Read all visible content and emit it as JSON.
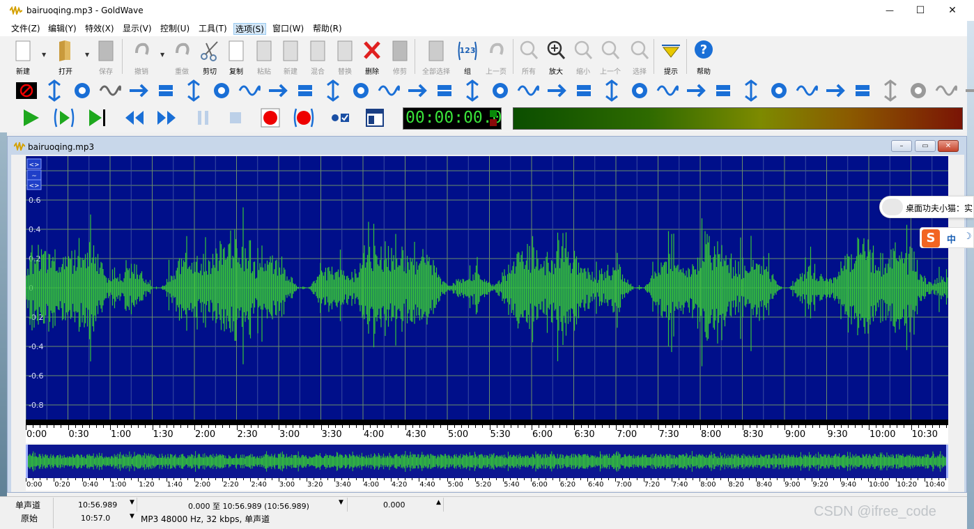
{
  "window": {
    "title": "bairuoqing.mp3 - GoldWave",
    "minimize": "—",
    "maximize": "☐",
    "close": "✕"
  },
  "menu": [
    {
      "label": "文件(Z)"
    },
    {
      "label": "编辑(Y)"
    },
    {
      "label": "特效(X)"
    },
    {
      "label": "显示(V)"
    },
    {
      "label": "控制(U)"
    },
    {
      "label": "工具(T)"
    },
    {
      "label": "选项(S)"
    },
    {
      "label": "窗口(W)"
    },
    {
      "label": "帮助(R)"
    }
  ],
  "toolbar": {
    "buttons": [
      {
        "label": "新建",
        "icon": "new-file-icon"
      },
      {
        "label": "打开",
        "icon": "open-folder-icon"
      },
      {
        "label": "保存",
        "icon": "save-disk-icon"
      },
      {
        "label": "撤销",
        "icon": "undo-icon"
      },
      {
        "label": "重做",
        "icon": "redo-icon"
      },
      {
        "label": "剪切",
        "icon": "scissors-icon"
      },
      {
        "label": "复制",
        "icon": "copy-icon"
      },
      {
        "label": "粘贴",
        "icon": "paste-icon"
      },
      {
        "label": "新建",
        "icon": "paste-new-icon"
      },
      {
        "label": "混合",
        "icon": "mix-icon"
      },
      {
        "label": "替换",
        "icon": "replace-icon"
      },
      {
        "label": "删除",
        "icon": "delete-x-icon"
      },
      {
        "label": "修剪",
        "icon": "trim-icon"
      },
      {
        "label": "全部选择",
        "icon": "select-all-icon"
      },
      {
        "label": "组",
        "icon": "group-123-icon"
      },
      {
        "label": "上一页",
        "icon": "previous-icon"
      },
      {
        "label": "所有",
        "icon": "zoom-all-icon"
      },
      {
        "label": "放大",
        "icon": "zoom-in-icon"
      },
      {
        "label": "缩小",
        "icon": "zoom-out-icon"
      },
      {
        "label": "上一个",
        "icon": "zoom-previous-icon"
      },
      {
        "label": "选择",
        "icon": "zoom-selection-icon"
      },
      {
        "label": "提示",
        "icon": "cue-triangle-icon"
      },
      {
        "label": "帮助",
        "icon": "help-question-icon"
      }
    ]
  },
  "counter": {
    "time": "00:00:00.0"
  },
  "document": {
    "title": "bairuoqing.mp3",
    "restore": "▭",
    "minimize": "–",
    "close": "✕"
  },
  "chart_data": {
    "type": "area",
    "title": "",
    "ylim": [
      -0.9,
      0.9
    ],
    "y_ticks": [
      "0.6",
      "0.4",
      "0.2",
      "0",
      "-0.2",
      "-0.4",
      "-0.6",
      "-0.8"
    ],
    "x_ticks": [
      "0:00",
      "0:30",
      "1:00",
      "1:30",
      "2:00",
      "2:30",
      "3:00",
      "3:30",
      "4:00",
      "4:30",
      "5:00",
      "5:30",
      "6:00",
      "6:30",
      "7:00",
      "7:30",
      "8:00",
      "8:30",
      "9:00",
      "9:30",
      "10:00",
      "10:30"
    ],
    "overview_ticks": [
      "0:00",
      "0:20",
      "0:40",
      "1:00",
      "1:20",
      "1:40",
      "2:00",
      "2:20",
      "2:40",
      "3:00",
      "3:20",
      "3:40",
      "4:00",
      "4:20",
      "4:40",
      "5:00",
      "5:20",
      "5:40",
      "6:00",
      "6:20",
      "6:40",
      "7:00",
      "7:20",
      "7:40",
      "8:00",
      "8:20",
      "8:40",
      "9:00",
      "9:20",
      "9:40",
      "10:00",
      "10:20",
      "10:40"
    ],
    "duration": "10:56.989",
    "series": [
      {
        "color": "#35c43a"
      }
    ],
    "grid": true
  },
  "status": {
    "channel": "单声道",
    "length": "10:56.989",
    "selection": "0.000 至 10:56.989 (10:56.989)",
    "position": "0.000",
    "original_label": "原始",
    "original_value": "10:57.0",
    "format": "MP3 48000 Hz, 32 kbps, 单声道"
  },
  "ime": {
    "notice": "桌面功夫小猫：实",
    "mode": "中"
  },
  "watermark": "CSDN @ifree_code",
  "colors": {
    "wave_bg": "#000f8a",
    "wave_fg": "#35c43a",
    "grid": "#6b8f6b"
  }
}
